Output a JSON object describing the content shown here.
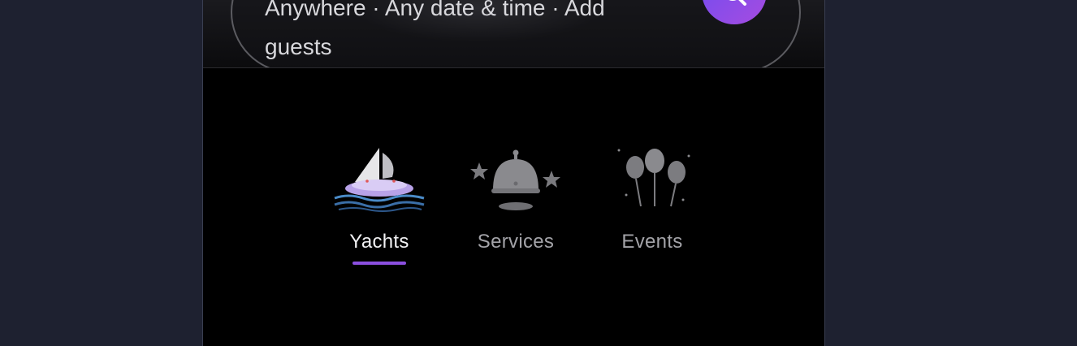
{
  "search": {
    "summary_line1": "Anywhere · Any date & time · Add",
    "summary_line2": "guests"
  },
  "tabs": [
    {
      "label": "Yachts",
      "icon": "yacht-icon",
      "active": true
    },
    {
      "label": "Services",
      "icon": "concierge-bell-icon",
      "active": false
    },
    {
      "label": "Events",
      "icon": "balloons-icon",
      "active": false
    }
  ],
  "colors": {
    "accent": "#8b4fe0",
    "search_button_start": "#6d4df2",
    "search_button_end": "#a64be0",
    "background": "#000000",
    "outer_background": "#1e2130"
  }
}
